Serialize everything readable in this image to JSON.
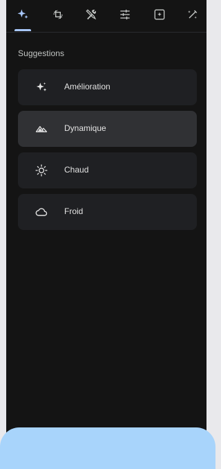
{
  "toolbar": {
    "tools": [
      {
        "name": "suggestions",
        "icon": "sparkle-icon",
        "active": true
      },
      {
        "name": "crop",
        "icon": "crop-rotate-icon",
        "active": false
      },
      {
        "name": "tools",
        "icon": "tools-icon",
        "active": false
      },
      {
        "name": "adjust",
        "icon": "sliders-icon",
        "active": false
      },
      {
        "name": "filters",
        "icon": "filter-icon",
        "active": false
      },
      {
        "name": "markup",
        "icon": "magic-pen-icon",
        "active": false
      }
    ],
    "active_color": "#a8c7fa",
    "inactive_color": "#c4c7c5"
  },
  "section": {
    "title": "Suggestions"
  },
  "suggestions": [
    {
      "label": "Amélioration",
      "icon": "sparkle-icon",
      "selected": false
    },
    {
      "label": "Dynamique",
      "icon": "mountain-icon",
      "selected": true
    },
    {
      "label": "Chaud",
      "icon": "sun-icon",
      "selected": false
    },
    {
      "label": "Froid",
      "icon": "cloud-icon",
      "selected": false
    }
  ],
  "colors": {
    "panel_bg": "#141414",
    "card_bg": "#1f2023",
    "card_selected_bg": "#303134",
    "bottom_sheet": "#a8d4fb"
  }
}
